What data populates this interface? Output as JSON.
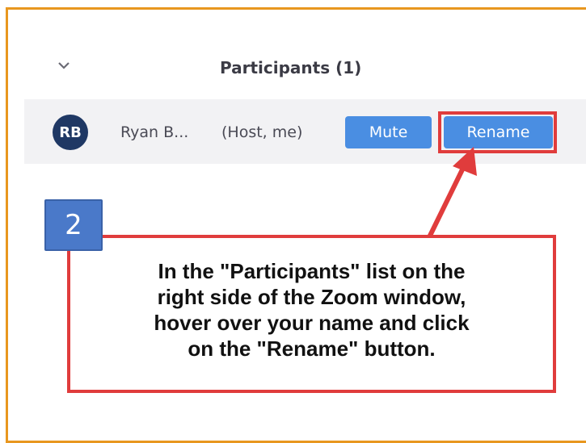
{
  "panel": {
    "title": "Participants (1)",
    "collapse_icon": "chevron-down-icon"
  },
  "participant": {
    "initials": "RB",
    "name": "Ryan B...",
    "role": "(Host, me)",
    "avatar_color": "#1f3864",
    "mute_label": "Mute",
    "rename_label": "Rename"
  },
  "annotation": {
    "step_number": "2",
    "lines": [
      "In the \"Participants\" list on the",
      "right side of the Zoom window,",
      "hover over your name and click",
      "on the \"Rename\" button."
    ],
    "highlight_color": "#e03c3c",
    "frame_color": "#e8971f",
    "button_color": "#4a8ee2"
  }
}
